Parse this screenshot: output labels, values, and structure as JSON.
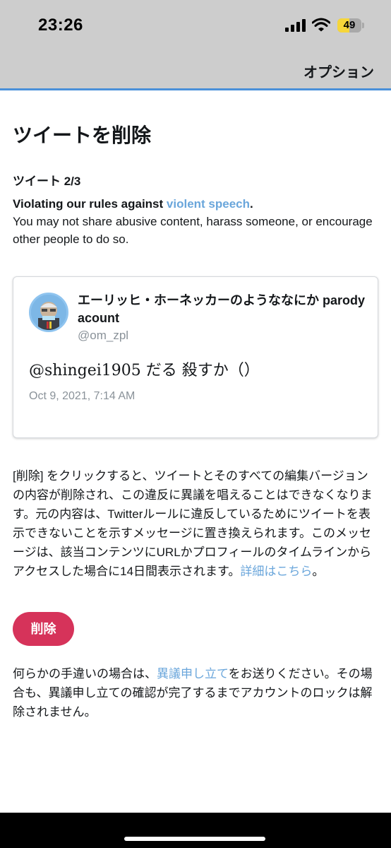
{
  "status_bar": {
    "time": "23:26",
    "battery_level": "49",
    "battery_fraction": 0.49,
    "icons": [
      "signal-icon",
      "wifi-icon",
      "battery-icon"
    ]
  },
  "nav": {
    "options_label": "オプション"
  },
  "page": {
    "title": "ツイートを削除",
    "tweet_count": "ツイート 2/3",
    "violation_prefix": "Violating our rules against ",
    "violation_link": "violent speech",
    "violation_suffix": ".",
    "violation_detail": "You may not share abusive content, harass someone, or encourage other people to do so."
  },
  "tweet": {
    "display_name": "エーリッヒ・ホーネッカーのようななにか parody acount",
    "handle": "@om_zpl",
    "text": "@shingei1905 だる 殺すか（）",
    "date": "Oct 9, 2021, 7:14 AM"
  },
  "info": {
    "text": "[削除] をクリックすると、ツイートとそのすべての編集バージョンの内容が削除され、この違反に異議を唱えることはできなくなります。元の内容は、Twitterルールに違反しているためにツイートを表示できないことを示すメッセージに置き換えられます。このメッセージは、該当コンテンツにURLかプロフィールのタイムラインからアクセスした場合に14日間表示されます。",
    "link": "詳細はこちら",
    "suffix": "。"
  },
  "actions": {
    "delete_label": "削除"
  },
  "appeal": {
    "prefix": "何らかの手違いの場合は、",
    "link": "異議申し立て",
    "suffix": "をお送りください。その場合も、異議申し立ての確認が完了するまでアカウントのロックは解除されません。"
  },
  "colors": {
    "accent_link": "#6aa6db",
    "delete_button": "#d6335a",
    "nav_background": "#cdcdcd",
    "nav_underline": "#4a90d9"
  }
}
